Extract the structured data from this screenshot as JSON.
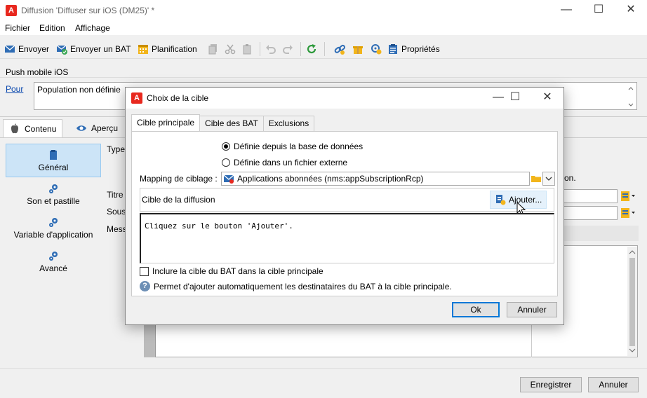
{
  "window": {
    "title": "Diffusion 'Diffuser sur iOS (DM25)' *",
    "logo_letter": "A",
    "minimize": "—",
    "maximize": "☐",
    "close": "✕"
  },
  "menu": [
    "Fichier",
    "Edition",
    "Affichage"
  ],
  "toolbar": {
    "send": "Envoyer",
    "send_proof": "Envoyer un BAT",
    "schedule": "Planification",
    "properties": "Propriétés"
  },
  "main": {
    "section_title": "Push mobile iOS",
    "link_pour": "Pour",
    "population": "Population non définie",
    "tabs": [
      "Contenu",
      "Aperçu"
    ],
    "nav": [
      "Général",
      "Son et pastille",
      "Variable d'application",
      "Avancé"
    ],
    "labels": {
      "type": "Type",
      "title": "Titre",
      "subtitle": "Sous",
      "message": "Mess"
    },
    "partial_text": "on."
  },
  "bottom": {
    "save": "Enregistrer",
    "cancel": "Annuler"
  },
  "dialog": {
    "title": "Choix de la cible",
    "tabs": [
      "Cible principale",
      "Cible des BAT",
      "Exclusions"
    ],
    "radio_db": "Définie depuis la base de données",
    "radio_file": "Définie dans un fichier externe",
    "mapping_label": "Mapping de ciblage :",
    "mapping_value": "Applications abonnées (nms:appSubscriptionRcp)",
    "target_label": "Cible de la diffusion",
    "add_button": "Ajouter...",
    "hint": "Cliquez sur le bouton 'Ajouter'.",
    "include_checkbox": "Inclure la cible du BAT dans la cible principale",
    "help_text": "Permet d'ajouter automatiquement les destinataires du BAT à la cible principale.",
    "ok": "Ok",
    "cancel": "Annuler"
  },
  "colors": {
    "brand": "#e8281e",
    "accent": "#0078d7",
    "selected": "#cce4f7"
  }
}
